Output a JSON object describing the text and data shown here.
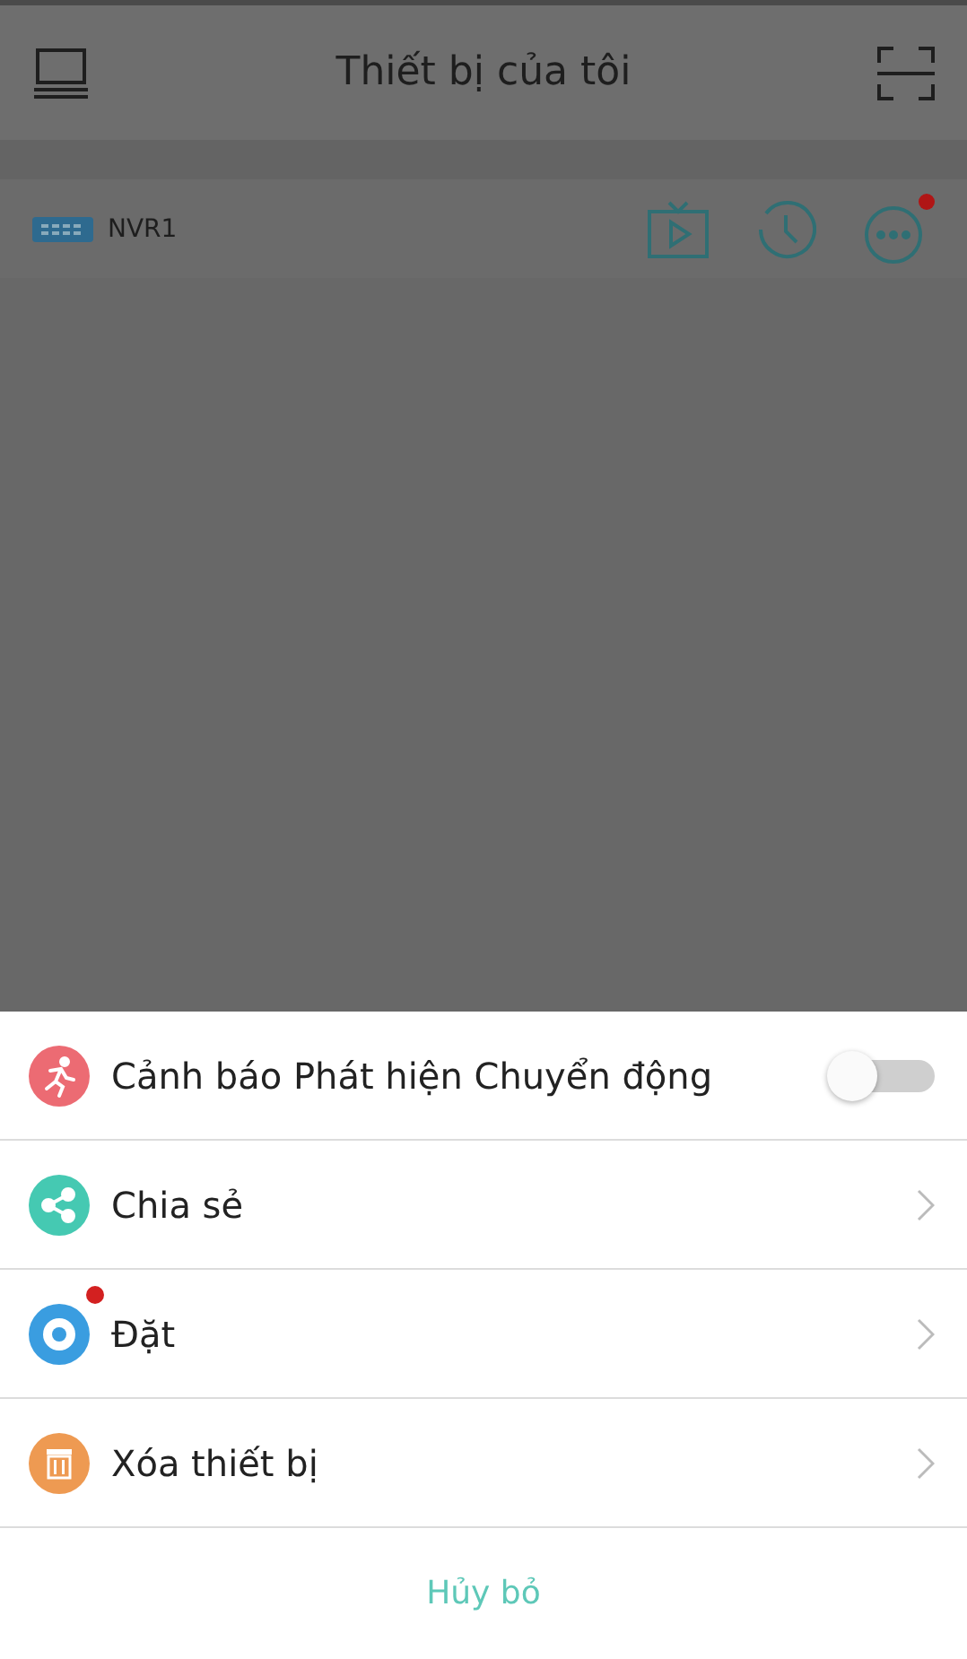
{
  "header": {
    "title": "Thiết bị của tôi"
  },
  "device": {
    "name": "NVR1",
    "more_badge": true
  },
  "sheet": {
    "items": [
      {
        "kind": "toggle",
        "label": "Cảnh báo Phát hiện Chuyển động",
        "on": false,
        "badge": false
      },
      {
        "kind": "link",
        "label": "Chia sẻ",
        "badge": false
      },
      {
        "kind": "link",
        "label": "Đặt",
        "badge": true
      },
      {
        "kind": "link",
        "label": "Xóa thiết bị",
        "badge": false
      }
    ],
    "cancel": "Hủy bỏ"
  }
}
